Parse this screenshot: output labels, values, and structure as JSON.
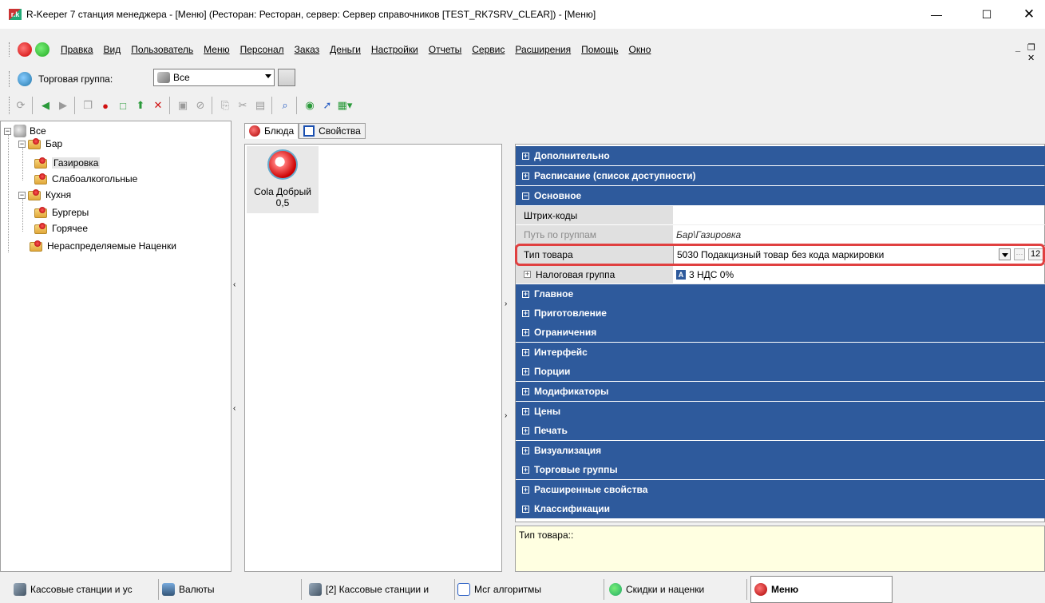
{
  "window": {
    "app_icon_text": "r.k",
    "title": "R-Keeper 7 станция менеджера - [Меню] (Ресторан: Ресторан, сервер: Сервер справочников [TEST_RK7SRV_CLEAR]) - [Меню]",
    "minimize_glyph": "—",
    "maximize_glyph": "☐",
    "close_glyph": "✕"
  },
  "menubar": {
    "items": [
      "Правка",
      "Вид",
      "Пользователь",
      "Меню",
      "Персонал",
      "Заказ",
      "Деньги",
      "Настройки",
      "Отчеты",
      "Сервис",
      "Расширения",
      "Помощь",
      "Окно"
    ],
    "mdi_minimize_glyph": "_",
    "mdi_restore_glyph": "❐ ✕"
  },
  "groupbar": {
    "label": "Торговая группа:",
    "selected": "Все"
  },
  "toolbar": {
    "icons": [
      "refresh-icon",
      "back-icon",
      "forward-icon",
      "copy-icon",
      "dish-icon",
      "new-icon",
      "import-icon",
      "delete-icon",
      "save-icon",
      "cancel-icon",
      "paste-icon",
      "cut-icon",
      "clipboard-icon",
      "search-icon",
      "filter-icon",
      "export-icon",
      "grid-icon"
    ]
  },
  "tree": {
    "root": "Все",
    "groups": [
      {
        "label": "Бар",
        "children": [
          "Газировка",
          "Слабоалкогольные"
        ]
      },
      {
        "label": "Кухня",
        "children": [
          "Бургеры",
          "Горячее"
        ]
      },
      {
        "label": "Нераспределяемые Наценки",
        "children": []
      }
    ],
    "selected": "Газировка"
  },
  "tabs": [
    {
      "label": "Блюда"
    },
    {
      "label": "Свойства"
    }
  ],
  "dish": {
    "name": "Cola Добрый",
    "volume": "0,5"
  },
  "propgrid": {
    "categories_top": [
      "Дополнительно",
      "Расписание (список доступности)",
      "Основное"
    ],
    "props": [
      {
        "name": "Штрих-коды",
        "value": ""
      },
      {
        "name": "Путь по группам",
        "value": "Бар\\Газировка"
      },
      {
        "name": "Тип товара",
        "value": "5030 Подакцизный товар без кода маркировки",
        "code": "12"
      },
      {
        "name": "Налоговая группа",
        "value": "3 НДС 0%",
        "tax_icon": "A"
      }
    ],
    "categories_bottom": [
      "Главное",
      "Приготовление",
      "Ограничения",
      "Интерфейс",
      "Порции",
      "Модификаторы",
      "Цены",
      "Печать",
      "Визуализация",
      "Торговые группы",
      "Расширенные свойства",
      "Классификации"
    ]
  },
  "help": {
    "text": "Тип товара::"
  },
  "taskbar": {
    "items": [
      "Кассовые станции и ус",
      "Валюты",
      "[2] Кассовые станции и",
      "Мсг алгоритмы",
      "Скидки и наценки",
      "Меню"
    ]
  },
  "colors": {
    "category_bg": "#2e5a9c",
    "highlight": "#e04040",
    "help_bg": "#ffffe1"
  }
}
